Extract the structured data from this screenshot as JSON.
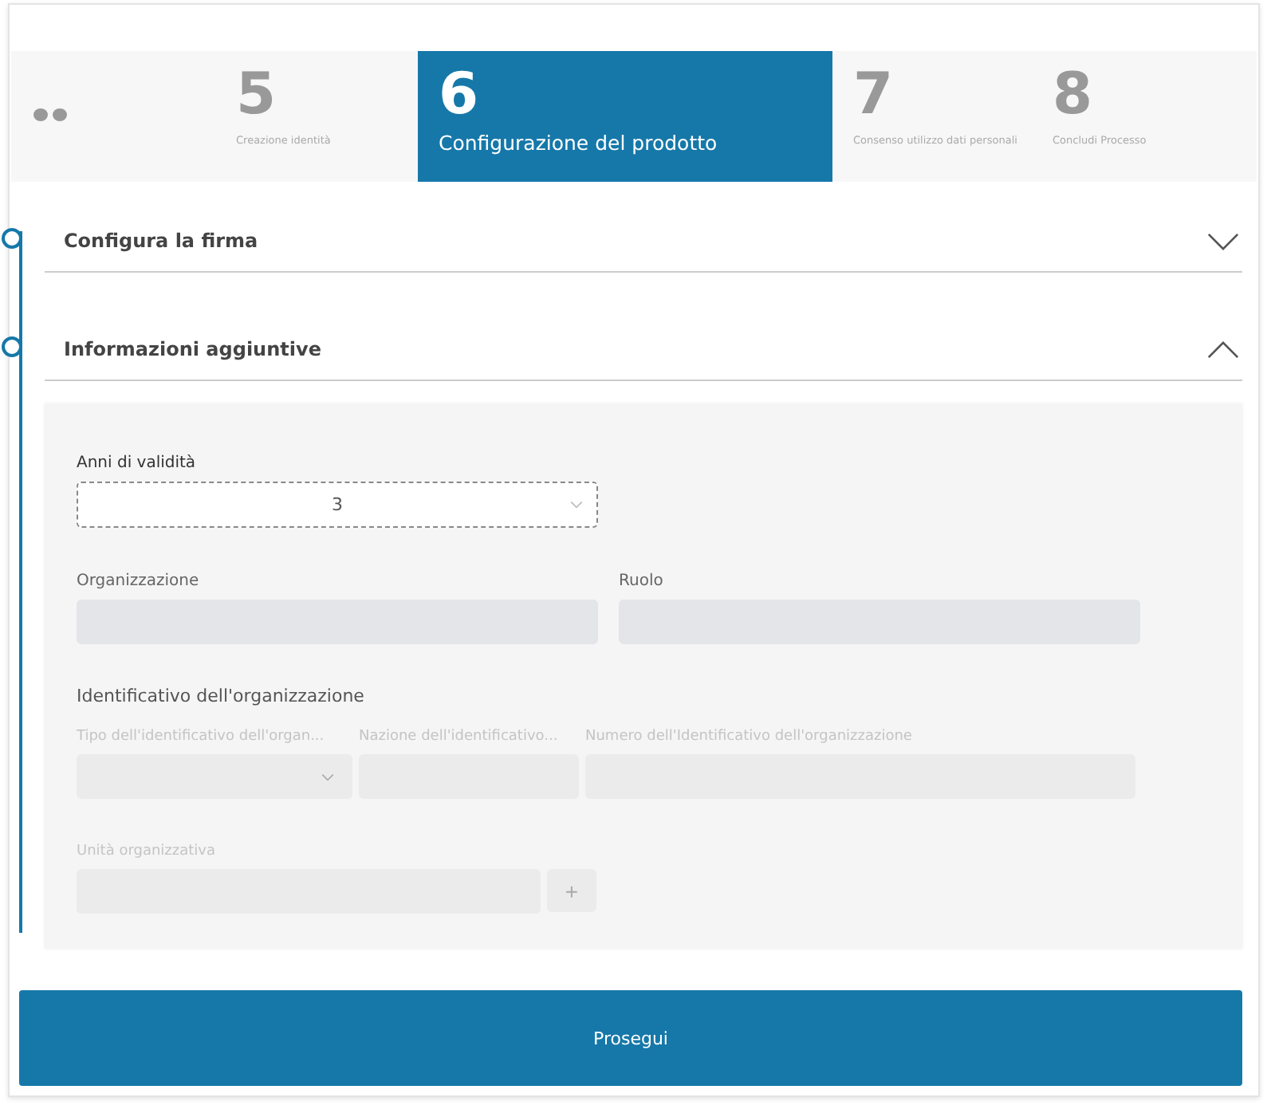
{
  "steps": [
    {
      "number": "5",
      "label": "Creazione identità",
      "selected": false
    },
    {
      "number": "6",
      "label": "Configurazione del prodotto",
      "selected": true
    },
    {
      "number": "7",
      "label": "Consenso utilizzo dati personali",
      "selected": false
    },
    {
      "number": "8",
      "label": "Concludi Processo",
      "selected": false
    }
  ],
  "sections": [
    {
      "title": "Configura la firma",
      "expanded": false
    },
    {
      "title": "Informazioni aggiuntive",
      "expanded": true
    }
  ],
  "validity": {
    "label": "Anni di validità",
    "value": "3",
    "disabled": false
  },
  "organization": {
    "label": "Organizzazione",
    "disabled": true
  },
  "role": {
    "label": "Ruolo",
    "disabled": true
  },
  "identifier": {
    "title": "Identificativo dell'organizzazione",
    "fields": [
      {
        "kind": "select",
        "label": "Tipo dell'identificativo dell'organ...",
        "disabled": true
      },
      {
        "kind": "text",
        "label": "Nazione dell'identificativo...",
        "disabled": true
      },
      {
        "kind": "text",
        "label": "Numero dell'Identificativo dell'organizzazione",
        "disabled": true
      }
    ]
  },
  "unit": {
    "label": "Unità organizzativa",
    "disabled": true,
    "add_label": "+"
  },
  "continue_button": "Prosegui"
}
